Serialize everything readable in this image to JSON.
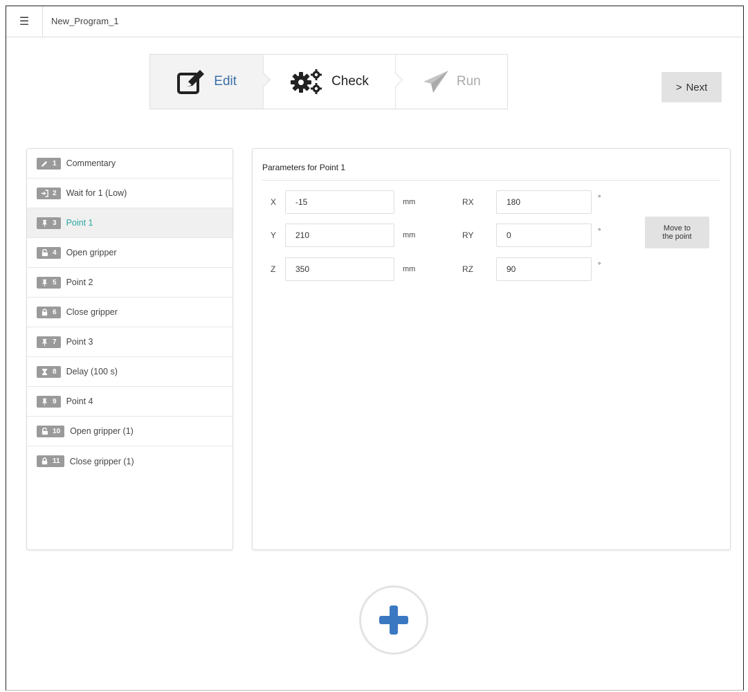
{
  "header": {
    "menu_icon": "hamburger-menu-icon",
    "program_title": "New_Program_1"
  },
  "stepper": {
    "steps": [
      {
        "label": "Edit",
        "icon": "edit-icon",
        "state": "active"
      },
      {
        "label": "Check",
        "icon": "gears-icon",
        "state": "default"
      },
      {
        "label": "Run",
        "icon": "paper-plane-icon",
        "state": "disabled"
      }
    ],
    "next_label": "Next"
  },
  "program": {
    "items": [
      {
        "num": "1",
        "label": "Commentary",
        "icon": "pencil-icon"
      },
      {
        "num": "2",
        "label": "Wait for 1 (Low)",
        "icon": "sign-in-icon"
      },
      {
        "num": "3",
        "label": "Point 1",
        "icon": "thumbtack-icon",
        "selected": true
      },
      {
        "num": "4",
        "label": "Open gripper",
        "icon": "unlock-icon"
      },
      {
        "num": "5",
        "label": "Point 2",
        "icon": "thumbtack-icon"
      },
      {
        "num": "6",
        "label": "Close gripper",
        "icon": "lock-icon"
      },
      {
        "num": "7",
        "label": "Point 3",
        "icon": "thumbtack-icon"
      },
      {
        "num": "8",
        "label": "Delay (100 s)",
        "icon": "hourglass-icon"
      },
      {
        "num": "9",
        "label": "Point 4",
        "icon": "thumbtack-icon"
      },
      {
        "num": "10",
        "label": "Open gripper (1)",
        "icon": "unlock-icon"
      },
      {
        "num": "11",
        "label": "Close gripper (1)",
        "icon": "lock-icon"
      }
    ]
  },
  "params": {
    "title": "Parameters for  Point 1",
    "rows": [
      {
        "label": "X",
        "value": "-15",
        "unit": "mm",
        "rlabel": "RX",
        "rvalue": "180",
        "runit": "°"
      },
      {
        "label": "Y",
        "value": "210",
        "unit": "mm",
        "rlabel": "RY",
        "rvalue": "0",
        "runit": "°"
      },
      {
        "label": "Z",
        "value": "350",
        "unit": "mm",
        "rlabel": "RZ",
        "rvalue": "90",
        "runit": "°"
      }
    ],
    "move_label": "Move to\nthe point"
  },
  "add_button": {
    "icon": "plus-icon"
  },
  "colors": {
    "accent_blue": "#3d6fa8",
    "selected_teal": "#2aa9a0",
    "badge_gray": "#9a9a9a",
    "plus_blue": "#3b78c2"
  }
}
